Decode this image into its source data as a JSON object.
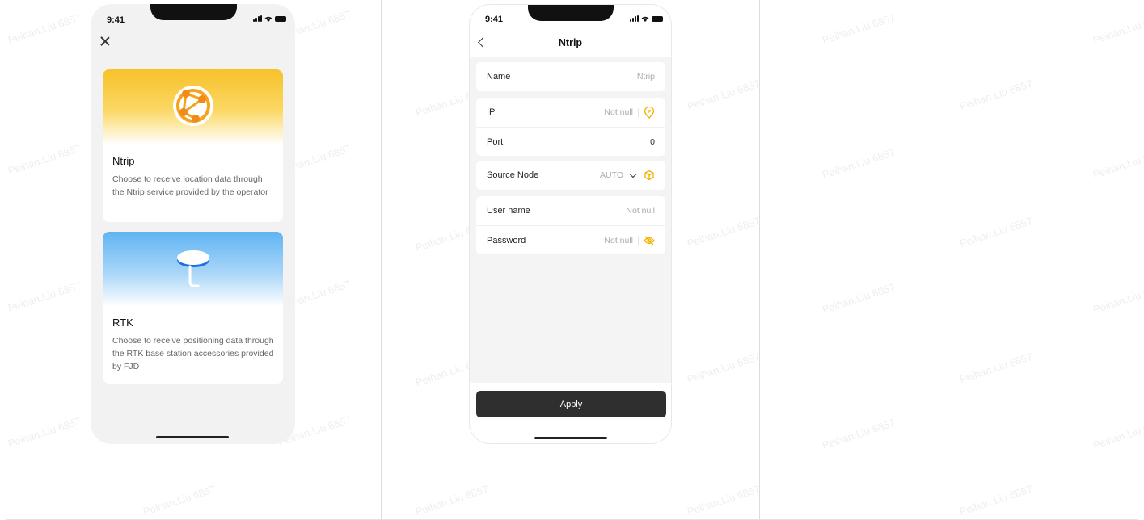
{
  "watermark": "Peihan.Liu 6857",
  "screen_select": {
    "status_time": "9:41",
    "options": [
      {
        "title": "Ntrip",
        "description": "Choose to receive location data through the Ntrip service provided by the operator",
        "icon": "globe-network-icon",
        "accent": "#f7b500"
      },
      {
        "title": "RTK",
        "description": "Choose to receive positioning data through the RTK base station accessories provided by FJD",
        "icon": "rtk-antenna-icon",
        "accent": "#3a9cf0"
      }
    ]
  },
  "screen_ntrip": {
    "status_time": "9:41",
    "title": "Ntrip",
    "fields": {
      "name": {
        "label": "Name",
        "placeholder": "Ntrip"
      },
      "ip": {
        "label": "IP",
        "placeholder": "Not null",
        "icon": "ip-location-icon"
      },
      "port": {
        "label": "Port",
        "value": "0"
      },
      "source_node": {
        "label": "Source Node",
        "value": "AUTO",
        "icon": "cube-icon"
      },
      "username": {
        "label": "User name",
        "placeholder": "Not null"
      },
      "password": {
        "label": "Password",
        "placeholder": "Not null",
        "icon": "eye-hidden-icon"
      }
    },
    "apply_label": "Apply",
    "accent": "#f0b400",
    "button_color": "#2f2f2f"
  }
}
